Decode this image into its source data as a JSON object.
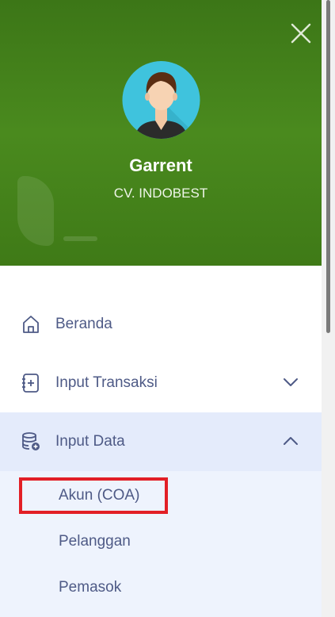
{
  "header": {
    "close_icon": "close-icon",
    "avatar_icon": "user-avatar-icon",
    "user_name": "Garrent",
    "company": "CV. INDOBEST"
  },
  "menu": {
    "items": [
      {
        "label": "Beranda",
        "icon": "home-icon"
      },
      {
        "label": "Input Transaksi",
        "icon": "add-document-icon",
        "chevron": "chevron-down-icon"
      },
      {
        "label": "Input Data",
        "icon": "database-icon",
        "chevron": "chevron-up-icon",
        "expanded": true
      }
    ],
    "submenu": [
      {
        "label": "Akun (COA)",
        "highlighted": true
      },
      {
        "label": "Pelanggan"
      },
      {
        "label": "Pemasok"
      }
    ]
  },
  "colors": {
    "header_green": "#4a8a1e",
    "menu_text": "#4e5a86",
    "active_bg": "#e4ebfb",
    "submenu_bg": "#eef3fd",
    "highlight_red": "#e21f26"
  }
}
